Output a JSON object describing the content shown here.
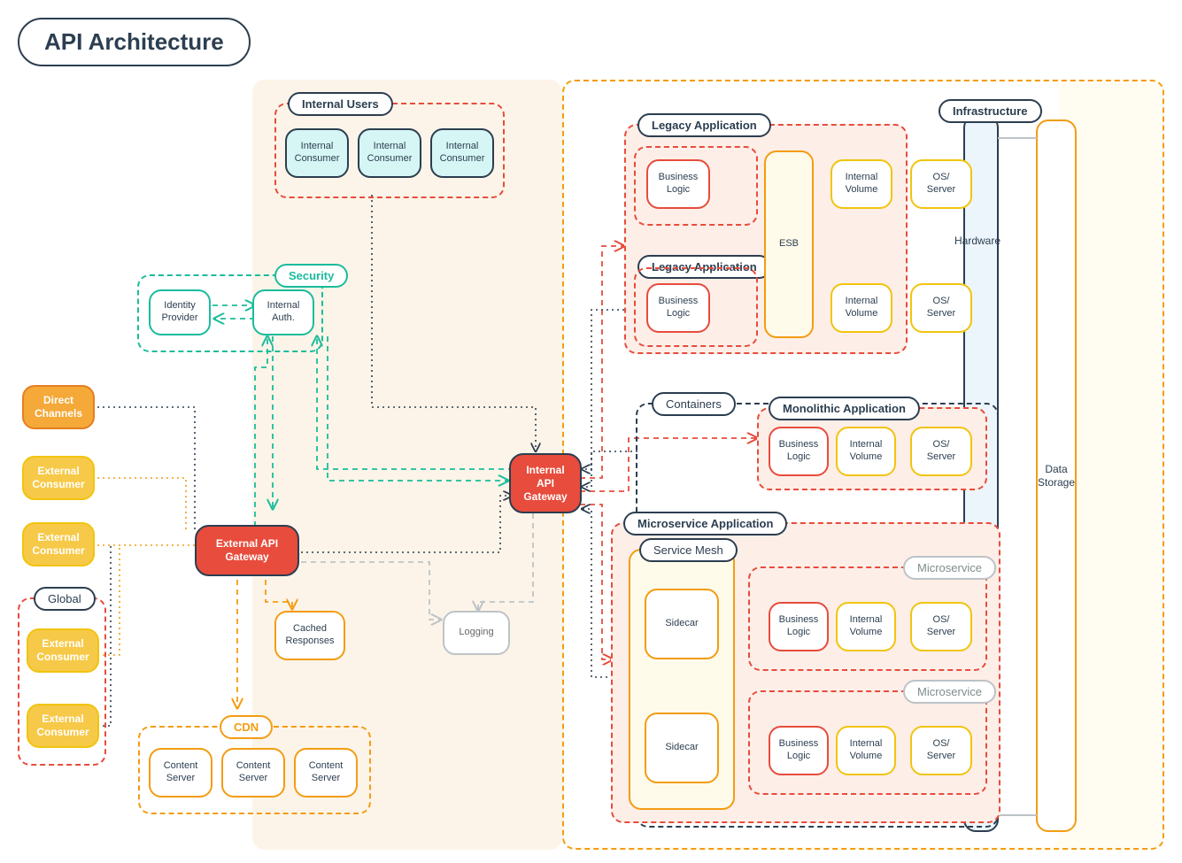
{
  "title": "API Architecture",
  "consumers": {
    "direct_channels": "Direct Channels",
    "external_consumer": "External Consumer",
    "global": "Global"
  },
  "gateways": {
    "external": "External API Gateway",
    "internal": "Internal API Gateway"
  },
  "internal_users": {
    "label": "Internal Users",
    "consumer": "Internal Consumer"
  },
  "security": {
    "label": "Security",
    "idp": "Identity Provider",
    "auth": "Internal Auth."
  },
  "cdn": {
    "label": "CDN",
    "server": "Content Server"
  },
  "cached_responses": "Cached Responses",
  "logging": "Logging",
  "containers": "Containers",
  "legacy": {
    "label": "Legacy Application",
    "bl": "Business Logic",
    "iv": "Internal Volume",
    "oss": "OS/ Server",
    "esb": "ESB"
  },
  "monolithic": {
    "label": "Monolithic Application",
    "bl": "Business Logic",
    "iv": "Internal Volume",
    "oss": "OS/ Server"
  },
  "microservice": {
    "label": "Microservice Application",
    "mesh": "Service Mesh",
    "sidecar": "Sidecar",
    "ms": "Microservice",
    "bl": "Business Logic",
    "iv": "Internal Volume",
    "oss": "OS/ Server"
  },
  "infrastructure": {
    "label": "Infrastructure",
    "hardware": "Hardware",
    "data_storage": "Data Storage"
  },
  "colors": {
    "navy": "#2C3E50",
    "red": "#E74C3C",
    "orange": "#F39C12",
    "yellow": "#F1C40F",
    "teal": "#1ABC9C",
    "grey": "#BDC3C7"
  }
}
